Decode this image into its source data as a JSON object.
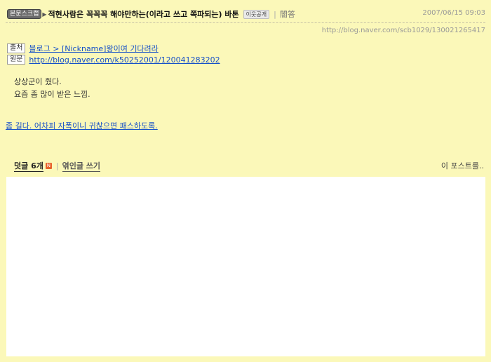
{
  "header": {
    "category_tag": "본문스크랩",
    "title": "적현사람은 꼭꼭꼭 해야만하는(이라고 쓰고 쪽파되는) 바톤",
    "visibility_badge": "이웃공개",
    "tool_link": "闇答",
    "date": "2007/06/15 09:03",
    "url": "http://blog.naver.com/scb1029/130021265417"
  },
  "source": {
    "source_label": "출처",
    "source_link": "블로그 > [Nickname]왕이여 기다려라",
    "original_label": "원문",
    "original_link": "http://blog.naver.com/k50252001/120041283202"
  },
  "body": {
    "lines": [
      "상상군이 줬다.",
      "요즘 좀 많이 받은 느낌."
    ]
  },
  "more_link": "좀 길다. 어차피 자폭이니 귀찮으면 패스하도록.",
  "comments": {
    "label": "덧글",
    "count": "6개",
    "new_icon": "N",
    "trackback": "엮인글 쓰기",
    "this_post": "이 포스트를.."
  }
}
